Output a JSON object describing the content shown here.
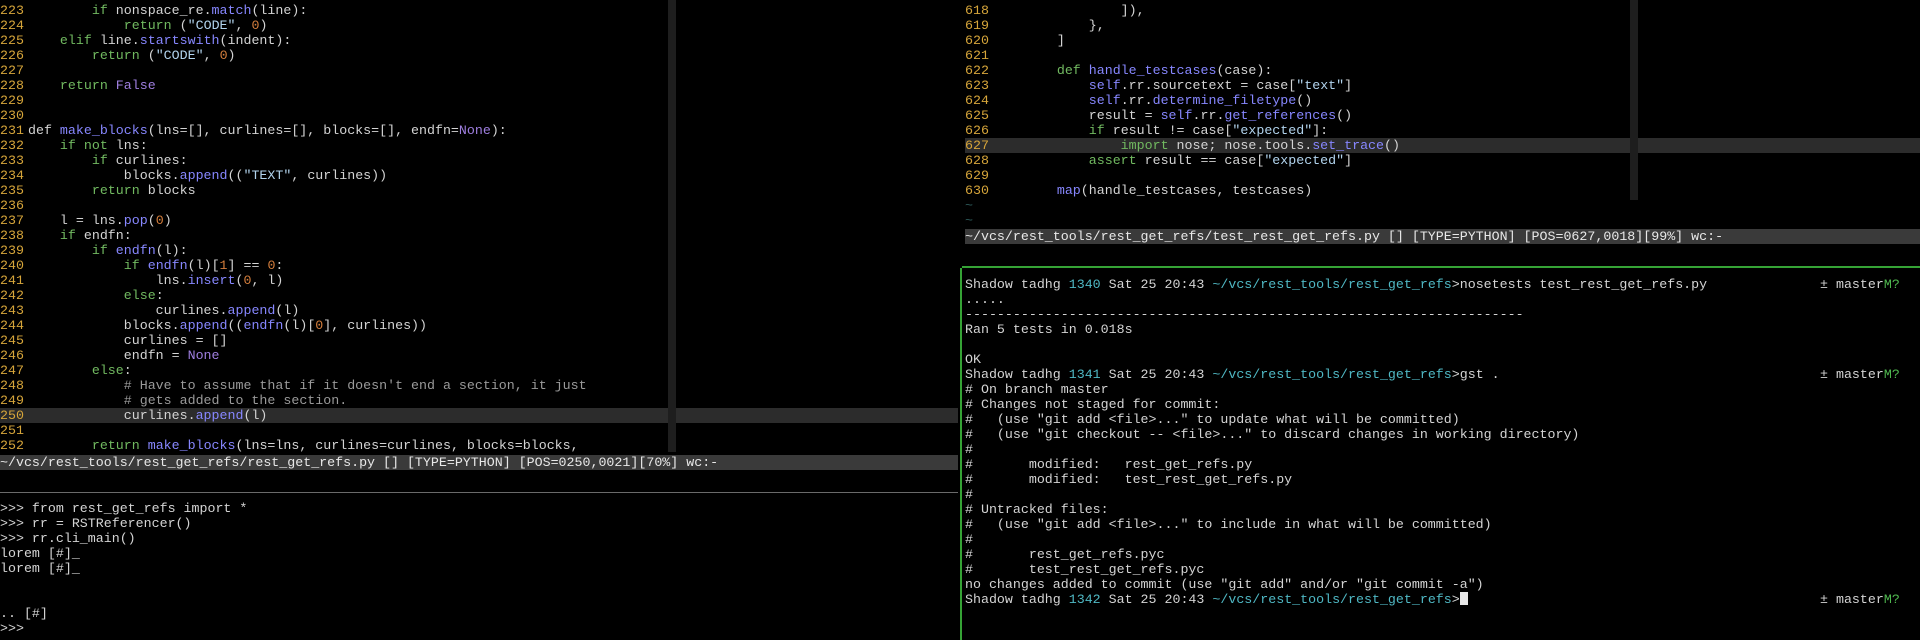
{
  "top_left_editor": {
    "lines": [
      {
        "n": "223",
        "segs": [
          [
            "",
            "        "
          ],
          [
            "kw",
            "if"
          ],
          [
            "",
            " nonspace_re."
          ],
          [
            "fn",
            "match"
          ],
          [
            "",
            "(line):"
          ]
        ]
      },
      {
        "n": "224",
        "segs": [
          [
            "",
            "            "
          ],
          [
            "kw",
            "return"
          ],
          [
            "",
            " ("
          ],
          [
            "str",
            "\"CODE\""
          ],
          [
            "",
            ", "
          ],
          [
            "num",
            "0"
          ],
          [
            "",
            ")"
          ]
        ]
      },
      {
        "n": "225",
        "segs": [
          [
            "",
            "    "
          ],
          [
            "kw",
            "elif"
          ],
          [
            "",
            " line."
          ],
          [
            "fn",
            "startswith"
          ],
          [
            "",
            "(indent):"
          ]
        ]
      },
      {
        "n": "226",
        "segs": [
          [
            "",
            "        "
          ],
          [
            "kw",
            "return"
          ],
          [
            "",
            " ("
          ],
          [
            "str",
            "\"CODE\""
          ],
          [
            "",
            ", "
          ],
          [
            "num",
            "0"
          ],
          [
            "",
            ")"
          ]
        ]
      },
      {
        "n": "227",
        "segs": []
      },
      {
        "n": "228",
        "segs": [
          [
            "",
            "    "
          ],
          [
            "kw",
            "return"
          ],
          [
            "",
            " "
          ],
          [
            "bool",
            "False"
          ]
        ]
      },
      {
        "n": "229",
        "segs": []
      },
      {
        "n": "230",
        "segs": []
      },
      {
        "n": "231",
        "segs": [
          [
            "",
            "def "
          ],
          [
            "fn",
            "make_blocks"
          ],
          [
            "",
            "(lns=[], curlines=[], blocks=[], endfn="
          ],
          [
            "bool",
            "None"
          ],
          [
            "",
            "):"
          ]
        ]
      },
      {
        "n": "232",
        "segs": [
          [
            "",
            "    "
          ],
          [
            "kw",
            "if not"
          ],
          [
            "",
            " lns:"
          ]
        ]
      },
      {
        "n": "233",
        "segs": [
          [
            "",
            "        "
          ],
          [
            "kw",
            "if"
          ],
          [
            "",
            " curlines:"
          ]
        ]
      },
      {
        "n": "234",
        "segs": [
          [
            "",
            "            blocks."
          ],
          [
            "fn",
            "append"
          ],
          [
            "",
            "(("
          ],
          [
            "str",
            "\"TEXT\""
          ],
          [
            "",
            ", curlines))"
          ]
        ]
      },
      {
        "n": "235",
        "segs": [
          [
            "",
            "        "
          ],
          [
            "kw",
            "return"
          ],
          [
            "",
            " blocks"
          ]
        ]
      },
      {
        "n": "236",
        "segs": []
      },
      {
        "n": "237",
        "segs": [
          [
            "",
            "    l = lns."
          ],
          [
            "fn",
            "pop"
          ],
          [
            "",
            "("
          ],
          [
            "num",
            "0"
          ],
          [
            "",
            ")"
          ]
        ]
      },
      {
        "n": "238",
        "segs": [
          [
            "",
            "    "
          ],
          [
            "kw",
            "if"
          ],
          [
            "",
            " endfn:"
          ]
        ]
      },
      {
        "n": "239",
        "segs": [
          [
            "",
            "        "
          ],
          [
            "kw",
            "if"
          ],
          [
            "",
            " "
          ],
          [
            "fn",
            "endfn"
          ],
          [
            "",
            "(l):"
          ]
        ]
      },
      {
        "n": "240",
        "segs": [
          [
            "",
            "            "
          ],
          [
            "kw",
            "if"
          ],
          [
            "",
            " "
          ],
          [
            "fn",
            "endfn"
          ],
          [
            "",
            "(l)["
          ],
          [
            "num",
            "1"
          ],
          [
            "",
            "] == "
          ],
          [
            "num",
            "0"
          ],
          [
            "",
            ":"
          ]
        ]
      },
      {
        "n": "241",
        "segs": [
          [
            "",
            "                lns."
          ],
          [
            "fn",
            "insert"
          ],
          [
            "",
            "("
          ],
          [
            "num",
            "0"
          ],
          [
            "",
            ", l)"
          ]
        ]
      },
      {
        "n": "242",
        "segs": [
          [
            "",
            "            "
          ],
          [
            "kw",
            "else"
          ],
          [
            "",
            ":"
          ]
        ]
      },
      {
        "n": "243",
        "segs": [
          [
            "",
            "                curlines."
          ],
          [
            "fn",
            "append"
          ],
          [
            "",
            "(l)"
          ]
        ]
      },
      {
        "n": "244",
        "segs": [
          [
            "",
            "            blocks."
          ],
          [
            "fn",
            "append"
          ],
          [
            "",
            "(("
          ],
          [
            "fn",
            "endfn"
          ],
          [
            "",
            "(l)["
          ],
          [
            "num",
            "0"
          ],
          [
            "",
            "], curlines))"
          ]
        ]
      },
      {
        "n": "245",
        "segs": [
          [
            "",
            "            curlines = []"
          ]
        ]
      },
      {
        "n": "246",
        "segs": [
          [
            "",
            "            endfn = "
          ],
          [
            "bool",
            "None"
          ]
        ]
      },
      {
        "n": "247",
        "segs": [
          [
            "",
            "        "
          ],
          [
            "kw",
            "else"
          ],
          [
            "",
            ":"
          ]
        ]
      },
      {
        "n": "248",
        "segs": [
          [
            "",
            "            "
          ],
          [
            "cm",
            "# Have to assume that if it doesn't end a section, it just"
          ]
        ]
      },
      {
        "n": "249",
        "segs": [
          [
            "",
            "            "
          ],
          [
            "cm",
            "# gets added to the section."
          ]
        ]
      },
      {
        "n": "250",
        "segs": [
          [
            "",
            "            curlines."
          ],
          [
            "fn",
            "append"
          ],
          [
            "",
            "(l)"
          ]
        ],
        "highlight": true
      },
      {
        "n": "251",
        "segs": []
      },
      {
        "n": "252",
        "segs": [
          [
            "",
            "        "
          ],
          [
            "kw",
            "return"
          ],
          [
            "",
            " "
          ],
          [
            "fn",
            "make_blocks"
          ],
          [
            "",
            "(lns=lns, curlines=curlines, blocks=blocks,"
          ]
        ]
      }
    ],
    "status": "~/vcs/rest_tools/rest_get_refs/rest_get_refs.py [] [TYPE=PYTHON] [POS=0250,0021][70%] wc:-"
  },
  "top_right_editor": {
    "lines": [
      {
        "n": "618",
        "segs": [
          [
            "",
            "                ]),"
          ]
        ]
      },
      {
        "n": "619",
        "segs": [
          [
            "",
            "            },"
          ]
        ]
      },
      {
        "n": "620",
        "segs": [
          [
            "",
            "        ]"
          ]
        ]
      },
      {
        "n": "621",
        "segs": []
      },
      {
        "n": "622",
        "segs": [
          [
            "",
            "        "
          ],
          [
            "kw",
            "def"
          ],
          [
            "",
            " "
          ],
          [
            "fn",
            "handle_testcases"
          ],
          [
            "",
            "(case):"
          ]
        ]
      },
      {
        "n": "623",
        "segs": [
          [
            "",
            "            "
          ],
          [
            "fn",
            "self"
          ],
          [
            "",
            ".rr.sourcetext = case["
          ],
          [
            "str",
            "\"text\""
          ],
          [
            "",
            "]"
          ]
        ]
      },
      {
        "n": "624",
        "segs": [
          [
            "",
            "            "
          ],
          [
            "fn",
            "self"
          ],
          [
            "",
            ".rr."
          ],
          [
            "fn",
            "determine_filetype"
          ],
          [
            "",
            "()"
          ]
        ]
      },
      {
        "n": "625",
        "segs": [
          [
            "",
            "            result = "
          ],
          [
            "fn",
            "self"
          ],
          [
            "",
            ".rr."
          ],
          [
            "fn",
            "get_references"
          ],
          [
            "",
            "()"
          ]
        ]
      },
      {
        "n": "626",
        "segs": [
          [
            "",
            "            "
          ],
          [
            "kw",
            "if"
          ],
          [
            "",
            " result != case["
          ],
          [
            "str",
            "\"expected\""
          ],
          [
            "",
            "]:"
          ]
        ]
      },
      {
        "n": "627",
        "segs": [
          [
            "",
            "                "
          ],
          [
            "kw",
            "import"
          ],
          [
            "",
            " nose; nose.tools."
          ],
          [
            "fn",
            "set_trace"
          ],
          [
            "",
            "()"
          ]
        ],
        "highlight": true
      },
      {
        "n": "628",
        "segs": [
          [
            "",
            "            "
          ],
          [
            "kw",
            "assert"
          ],
          [
            "",
            " result == case["
          ],
          [
            "str",
            "\"expected\""
          ],
          [
            "",
            "]"
          ]
        ]
      },
      {
        "n": "629",
        "segs": []
      },
      {
        "n": "630",
        "segs": [
          [
            "",
            "        "
          ],
          [
            "fn",
            "map"
          ],
          [
            "",
            "(handle_testcases, testcases)"
          ]
        ]
      }
    ],
    "tilde_lines": [
      "~",
      "~"
    ],
    "status": "~/vcs/rest_tools/rest_get_refs/test_rest_get_refs.py [] [TYPE=PYTHON] [POS=0627,0018][99%] wc:-"
  },
  "bottom_left_repl": {
    "lines": [
      ">>> from rest_get_refs import *",
      ">>> rr = RSTReferencer()",
      ">>> rr.cli_main()",
      "lorem [#]_",
      "lorem [#]_",
      "",
      "",
      ".. [#]",
      ">>>"
    ]
  },
  "bottom_right_shell": {
    "prompts": {
      "host": "Shadow tadhg",
      "datetime": "Sat 25 20:43",
      "cwd": "~/vcs/rest_tools/rest_get_refs",
      "branch_prefix": "± master",
      "branch_suffix": "M?"
    },
    "blocks": [
      {
        "type": "prompt",
        "num": "1340",
        "cmd": "nosetests test_rest_get_refs.py"
      },
      {
        "type": "text",
        "text": "....."
      },
      {
        "type": "text",
        "text": "----------------------------------------------------------------------"
      },
      {
        "type": "text",
        "text": "Ran 5 tests in 0.018s"
      },
      {
        "type": "text",
        "text": ""
      },
      {
        "type": "text",
        "text": "OK"
      },
      {
        "type": "prompt",
        "num": "1341",
        "cmd": "gst ."
      },
      {
        "type": "text",
        "text": "# On branch master"
      },
      {
        "type": "text",
        "text": "# Changes not staged for commit:"
      },
      {
        "type": "text",
        "text": "#   (use \"git add <file>...\" to update what will be committed)"
      },
      {
        "type": "text",
        "text": "#   (use \"git checkout -- <file>...\" to discard changes in working directory)"
      },
      {
        "type": "text",
        "text": "#"
      },
      {
        "type": "text",
        "text": "#       modified:   rest_get_refs.py"
      },
      {
        "type": "text",
        "text": "#       modified:   test_rest_get_refs.py"
      },
      {
        "type": "text",
        "text": "#"
      },
      {
        "type": "text",
        "text": "# Untracked files:"
      },
      {
        "type": "text",
        "text": "#   (use \"git add <file>...\" to include in what will be committed)"
      },
      {
        "type": "text",
        "text": "#"
      },
      {
        "type": "text",
        "text": "#       rest_get_refs.pyc"
      },
      {
        "type": "text",
        "text": "#       test_rest_get_refs.pyc"
      },
      {
        "type": "text",
        "text": "no changes added to commit (use \"git add\" and/or \"git commit -a\")"
      },
      {
        "type": "prompt",
        "num": "1342",
        "cmd": "",
        "cursor": true
      }
    ]
  }
}
